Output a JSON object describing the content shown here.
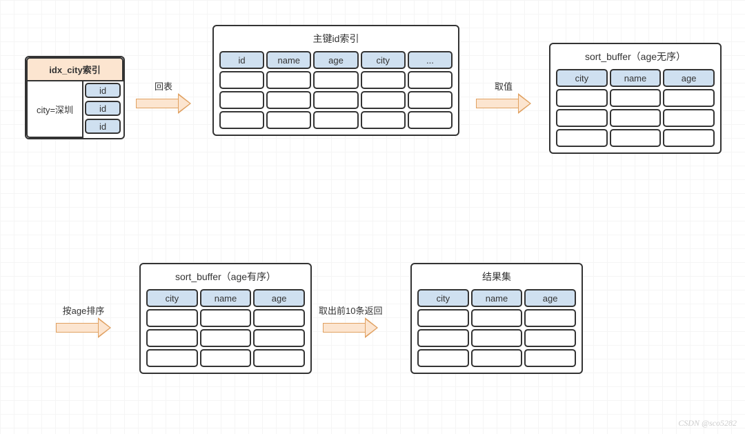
{
  "idxBox": {
    "title": "idx_city索引",
    "condition": "city=深圳",
    "ids": [
      "id",
      "id",
      "id"
    ]
  },
  "pkBox": {
    "title": "主键id索引",
    "headers": [
      "id",
      "name",
      "age",
      "city",
      "..."
    ]
  },
  "sortBufferUnordered": {
    "title": "sort_buffer（age无序）",
    "headers": [
      "city",
      "name",
      "age"
    ]
  },
  "sortBufferOrdered": {
    "title": "sort_buffer（age有序）",
    "headers": [
      "city",
      "name",
      "age"
    ]
  },
  "resultBox": {
    "title": "结果集",
    "headers": [
      "city",
      "name",
      "age"
    ]
  },
  "arrows": {
    "a1": "回表",
    "a2": "取值",
    "a3": "按age排序",
    "a4": "取出前10条返回"
  },
  "watermark": "CSDN @sco5282"
}
